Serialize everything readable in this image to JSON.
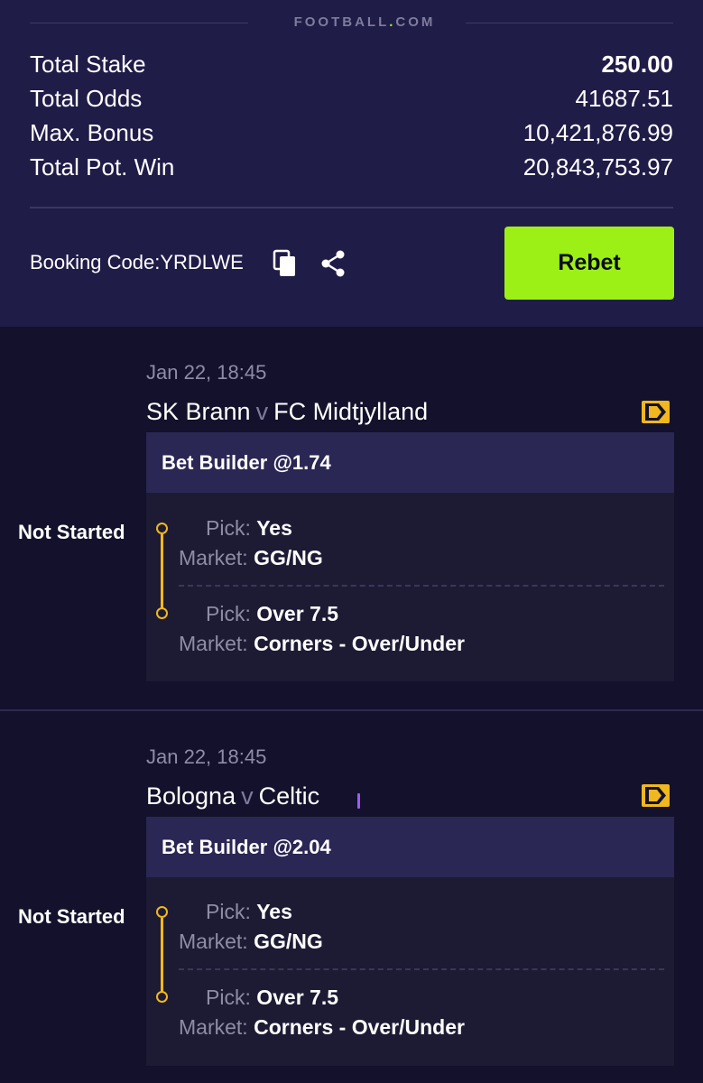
{
  "header": {
    "brand": "FOOTBALL.COM",
    "totals": [
      {
        "label": "Total Stake",
        "value": "250.00"
      },
      {
        "label": "Total Odds",
        "value": "41687.51"
      },
      {
        "label": "Max. Bonus",
        "value": "10,421,876.99"
      },
      {
        "label": "Total Pot. Win",
        "value": "20,843,753.97"
      }
    ],
    "booking_code": "Booking Code:YRDLWE",
    "rebet_label": "Rebet",
    "copy_icon": "copy-icon",
    "share_icon": "share-icon"
  },
  "bets": [
    {
      "status": "Not Started",
      "date": "Jan 22, 18:45",
      "home": "SK Brann",
      "vs": "v",
      "away": "FC Midtjylland",
      "builder": "Bet Builder @1.74",
      "selections": [
        {
          "pick_label": "Pick:",
          "pick": "Yes",
          "market_label": "Market:",
          "market": "GG/NG"
        },
        {
          "pick_label": "Pick:",
          "pick": "Over 7.5",
          "market_label": "Market:",
          "market": "Corners - Over/Under"
        }
      ]
    },
    {
      "status": "Not Started",
      "date": "Jan 22, 18:45",
      "home": "Bologna",
      "vs": "v",
      "away": "Celtic",
      "builder": "Bet Builder @2.04",
      "selections": [
        {
          "pick_label": "Pick:",
          "pick": "Yes",
          "market_label": "Market:",
          "market": "GG/NG"
        },
        {
          "pick_label": "Pick:",
          "pick": "Over 7.5",
          "market_label": "Market:",
          "market": "Corners - Over/Under"
        }
      ]
    }
  ],
  "colors": {
    "header_bg": "#201c48",
    "page_bg": "#13112b",
    "rebet": "#9cf016",
    "accent": "#f0b81e"
  }
}
